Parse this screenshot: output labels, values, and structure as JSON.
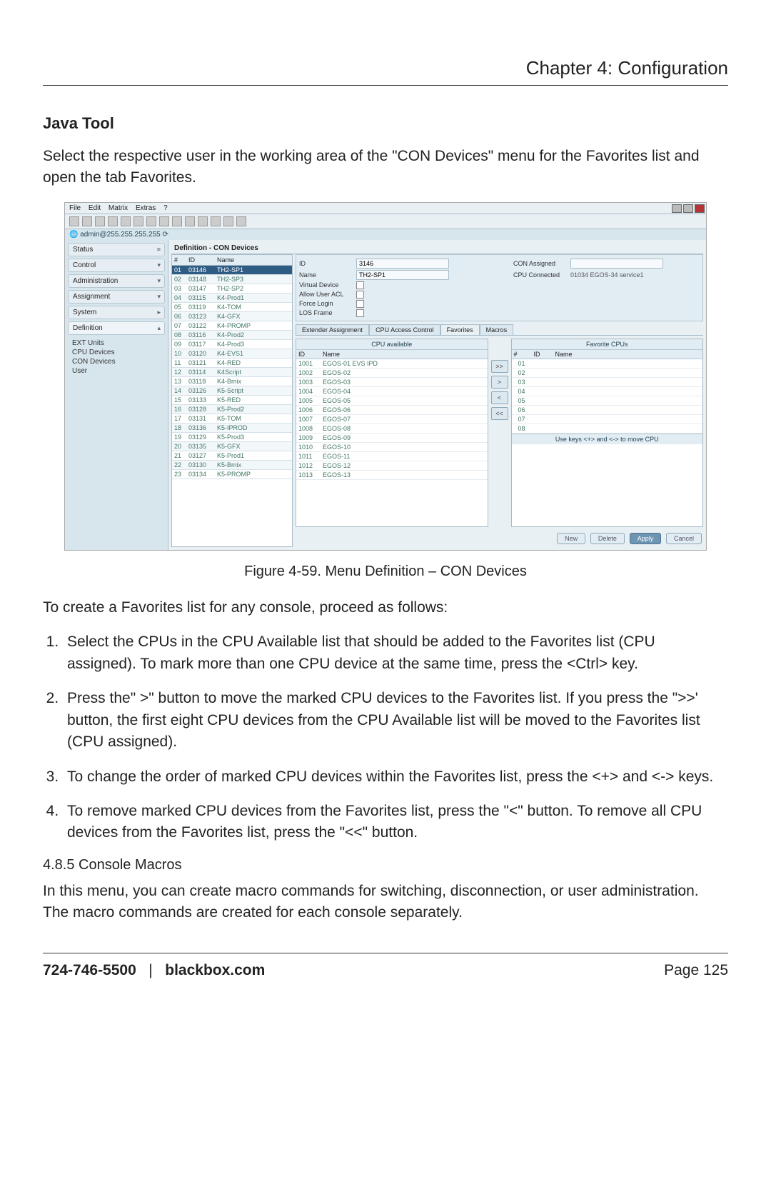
{
  "chapter": "Chapter 4: Configuration",
  "section": {
    "title": "Java Tool"
  },
  "intro": "Select the respective user in the working area of the \"CON Devices\" menu for the Favorites list and open the tab Favorites.",
  "figure_caption": "Figure 4-59. Menu Definition – CON Devices",
  "lead": "To create a Favorites list for any console, proceed as follows:",
  "steps": [
    "Select the CPUs in the CPU Available list that should be added to the Favorites list (CPU assigned). To mark more than one CPU device at the same time, press the <Ctrl> key.",
    "Press the\" >\"  button to move the marked CPU devices to the Favorites list. If you press the \">>' button, the first eight CPU devices from the CPU Available list will be moved to the Favorites list (CPU assigned).",
    "To change the order of marked CPU devices within the Favorites list, press the <+> and <-> keys.",
    "To remove marked CPU devices from the Favorites list, press the \"<\" button. To remove all CPU devices from the Favorites list, press the \"<<\" button."
  ],
  "subsection": {
    "num": "4.8.5",
    "title": "Console Macros"
  },
  "subsection_body": "In this menu, you can create macro commands for switching, disconnection, or user administration. The macro commands are created for each console separately.",
  "footer": {
    "phone": "724-746-5500",
    "site": "blackbox.com",
    "page": "Page 125"
  },
  "app": {
    "menus": [
      "File",
      "Edit",
      "Matrix",
      "Extras",
      "?"
    ],
    "connection": "admin@255.255.255.255",
    "sidebar": {
      "items": [
        {
          "label": "Status"
        },
        {
          "label": "Control"
        },
        {
          "label": "Administration"
        },
        {
          "label": "Assignment"
        },
        {
          "label": "System"
        },
        {
          "label": "Definition"
        }
      ],
      "tree": [
        "EXT Units",
        "CPU Devices",
        "CON Devices",
        "User"
      ]
    },
    "panel_title": "Definition - CON Devices",
    "device_list": {
      "cols": [
        "#",
        "ID",
        "Name"
      ],
      "rows": [
        {
          "n": "01",
          "id": "03146",
          "name": "TH2-SP1",
          "sel": true
        },
        {
          "n": "02",
          "id": "03148",
          "name": "TH2-SP3"
        },
        {
          "n": "03",
          "id": "03147",
          "name": "TH2-SP2"
        },
        {
          "n": "04",
          "id": "03115",
          "name": "K4-Prod1"
        },
        {
          "n": "05",
          "id": "03119",
          "name": "K4-TOM"
        },
        {
          "n": "06",
          "id": "03123",
          "name": "K4-GFX"
        },
        {
          "n": "07",
          "id": "03122",
          "name": "K4-PROMP"
        },
        {
          "n": "08",
          "id": "03116",
          "name": "K4-Prod2"
        },
        {
          "n": "09",
          "id": "03117",
          "name": "K4-Prod3"
        },
        {
          "n": "10",
          "id": "03120",
          "name": "K4-EVS1"
        },
        {
          "n": "11",
          "id": "03121",
          "name": "K4-RED"
        },
        {
          "n": "12",
          "id": "03114",
          "name": "K4Script"
        },
        {
          "n": "13",
          "id": "03118",
          "name": "K4-Bmix"
        },
        {
          "n": "14",
          "id": "03126",
          "name": "K5-Script"
        },
        {
          "n": "15",
          "id": "03133",
          "name": "K5-RED"
        },
        {
          "n": "16",
          "id": "03128",
          "name": "K5-Prod2"
        },
        {
          "n": "17",
          "id": "03131",
          "name": "K5-TOM"
        },
        {
          "n": "18",
          "id": "03136",
          "name": "K5-IPROD"
        },
        {
          "n": "19",
          "id": "03129",
          "name": "K5-Prod3"
        },
        {
          "n": "20",
          "id": "03135",
          "name": "K5-GFX"
        },
        {
          "n": "21",
          "id": "03127",
          "name": "K5-Prod1"
        },
        {
          "n": "22",
          "id": "03130",
          "name": "K5-Bmix"
        },
        {
          "n": "23",
          "id": "03134",
          "name": "K5-PROMP"
        }
      ]
    },
    "form": {
      "id_label": "ID",
      "id_value": "3146",
      "name_label": "Name",
      "name_value": "TH2-SP1",
      "virtual_label": "Virtual Device",
      "acl_label": "Allow User ACL",
      "force_label": "Force Login",
      "los_label": "LOS Frame",
      "con_assigned_label": "CON Assigned",
      "cpu_connected_label": "CPU Connected",
      "cpu_connected_value": "01034  EGOS-34 service1"
    },
    "subtabs": [
      "Extender Assignment",
      "CPU Access Control",
      "Favorites",
      "Macros"
    ],
    "fav": {
      "left_title": "CPU available",
      "right_title": "Favorite CPUs",
      "cols_left": [
        "ID",
        "Name"
      ],
      "cols_right": [
        "#",
        "ID",
        "Name"
      ],
      "left_rows": [
        {
          "id": "1001",
          "name": "EGOS-01 EVS IPD"
        },
        {
          "id": "1002",
          "name": "EGOS-02"
        },
        {
          "id": "1003",
          "name": "EGOS-03"
        },
        {
          "id": "1004",
          "name": "EGOS-04"
        },
        {
          "id": "1005",
          "name": "EGOS-05"
        },
        {
          "id": "1006",
          "name": "EGOS-06"
        },
        {
          "id": "1007",
          "name": "EGOS-07"
        },
        {
          "id": "1008",
          "name": "EGOS-08"
        },
        {
          "id": "1009",
          "name": "EGOS-09"
        },
        {
          "id": "1010",
          "name": "EGOS-10"
        },
        {
          "id": "1011",
          "name": "EGOS-11"
        },
        {
          "id": "1012",
          "name": "EGOS-12"
        },
        {
          "id": "1013",
          "name": "EGOS-13"
        }
      ],
      "right_rows": [
        {
          "n": "01"
        },
        {
          "n": "02"
        },
        {
          "n": "03"
        },
        {
          "n": "04"
        },
        {
          "n": "05"
        },
        {
          "n": "06"
        },
        {
          "n": "07"
        },
        {
          "n": "08"
        }
      ],
      "buttons": {
        "addall": ">>",
        "add": ">",
        "remove": "<",
        "removeall": "<<"
      },
      "hint": "Use keys <+> and <-> to move CPU"
    },
    "actions": {
      "new": "New",
      "delete": "Delete",
      "apply": "Apply",
      "cancel": "Cancel"
    }
  }
}
